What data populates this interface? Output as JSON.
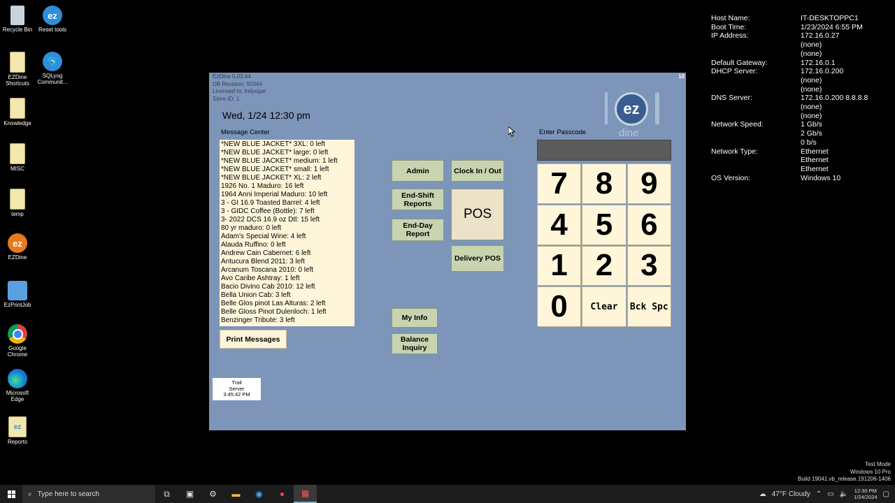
{
  "desktop": {
    "icons": [
      {
        "label": "Recycle Bin",
        "icon": "recycle-bin-icon"
      },
      {
        "label": "Reset tools",
        "icon": "ez-icon"
      },
      {
        "label": "EZDine Shortcuts",
        "icon": "folder-icon"
      },
      {
        "label": "SQLyog Communit...",
        "icon": "dolphin-icon"
      },
      {
        "label": "Knowledge",
        "icon": "file-icon"
      },
      {
        "label": "MISC",
        "icon": "file-icon"
      },
      {
        "label": "temp",
        "icon": "file-icon"
      },
      {
        "label": "EZDine",
        "icon": "ezdine-icon"
      },
      {
        "label": "EzPrintJob",
        "icon": "plug-icon"
      },
      {
        "label": "Google Chrome",
        "icon": "chrome-icon"
      },
      {
        "label": "Microsoft Edge",
        "icon": "edge-icon"
      },
      {
        "label": "Reports",
        "icon": "ez-reports-icon"
      }
    ]
  },
  "sysinfo": [
    {
      "key": "Host Name:",
      "value": "IT-DESKTOPPC1"
    },
    {
      "key": "Boot Time:",
      "value": "1/23/2024 6:55 PM"
    },
    {
      "key": "IP Address:",
      "value": "172.16.0.27"
    },
    {
      "key": "",
      "value": "(none)"
    },
    {
      "key": "",
      "value": "(none)"
    },
    {
      "key": "Default Gateway:",
      "value": "172.16.0.1"
    },
    {
      "key": "DHCP Server:",
      "value": "172.16.0.200"
    },
    {
      "key": "",
      "value": "(none)"
    },
    {
      "key": "",
      "value": "(none)"
    },
    {
      "key": "DNS Server:",
      "value": "172.16.0.200 8.8.8.8"
    },
    {
      "key": "",
      "value": "(none)"
    },
    {
      "key": "",
      "value": "(none)"
    },
    {
      "key": "Network Speed:",
      "value": "1 Gb/s"
    },
    {
      "key": "",
      "value": "2 Gb/s"
    },
    {
      "key": "",
      "value": "0 b/s"
    },
    {
      "key": "Network Type:",
      "value": "Ethernet"
    },
    {
      "key": "",
      "value": "Ethernet"
    },
    {
      "key": "",
      "value": "Ethernet"
    },
    {
      "key": "OS Version:",
      "value": "Windows 10"
    }
  ],
  "app": {
    "version_lines": [
      "EzDine 5.03.44",
      "DB Revision: 50344",
      "Licensed to: Indyogar",
      "Store ID: 1"
    ],
    "corner": "10",
    "logo": {
      "mark": "ez",
      "word": "dine"
    },
    "date": "Wed, 1/24  12:30 pm",
    "message_center_label": "Message Center",
    "messages": [
      "*NEW BLUE JACKET* 3XL: 0 left",
      "*NEW BLUE JACKET* large: 0 left",
      "*NEW BLUE JACKET* medium: 1 left",
      "*NEW BLUE JACKET* small: 1 left",
      "*NEW BLUE JACKET* XL: 2 left",
      "1926 No. 1 Maduro: 16 left",
      "1964 Anni Imperial Maduro: 10 left",
      "3 - GI 16.9 Toasted Barrel: 4 left",
      "3 - GIDC Coffee (Bottle): 7 left",
      "3- 2022 DCS 16.9 oz Dtl: 15 left",
      "80 yr maduro: 0 left",
      "Adam's Special Wine: 4 left",
      "Alauda Ruffino: 0 left",
      "Andrew Cain Cabernet: 6 left",
      "Antucura Blend 2011: 3 left",
      "Arcanum Toscana 2010: 0 left",
      "Avo Caribe Ashtray: 1 left",
      "Bacio Divino Cab 2010: 12 left",
      "Bella Union Cab: 3 left",
      "Belle Glos pinot Las Alturas: 2 left",
      "Belle Gloss Pinot Dulenloch: 1 left",
      "Benzinger Tribute: 3 left"
    ],
    "print_messages": "Print Messages",
    "buttons": {
      "admin": "Admin",
      "clock": "Clock In / Out",
      "end_shift": "End-Shift Reports",
      "pos": "POS",
      "end_day": "End-Day Report",
      "delivery": "Delivery POS",
      "my_info": "My Info",
      "balance": "Balance Inquiry"
    },
    "server_box": [
      "Trail",
      "Server",
      "3:45:42 PM"
    ],
    "passcode_label": "Enter Passcode",
    "keypad": [
      "7",
      "8",
      "9",
      "4",
      "5",
      "6",
      "1",
      "2",
      "3",
      "0",
      "Clear",
      "Bck Spc"
    ]
  },
  "watermark": [
    "Test Mode",
    "Windows 10 Pro",
    "Build 19041.vb_release.191206-1406"
  ],
  "taskbar": {
    "search_placeholder": "Type here to search",
    "weather": "47°F  Cloudy",
    "time": "12:30 PM",
    "date": "1/24/2024"
  }
}
